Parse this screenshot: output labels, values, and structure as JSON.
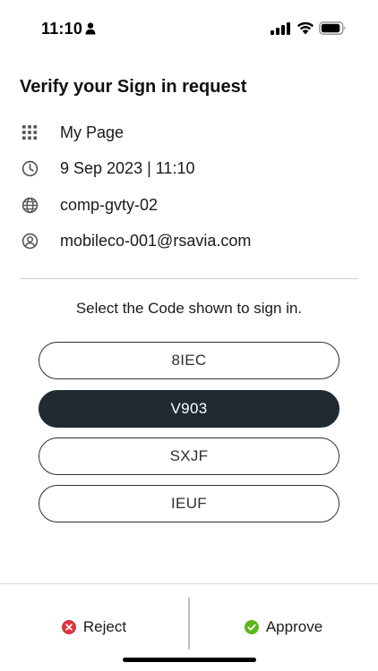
{
  "status_bar": {
    "time": "11:10"
  },
  "title": "Verify your Sign in request",
  "info": {
    "app": "My Page",
    "datetime": "9 Sep 2023 | 11:10",
    "device": "comp-gvty-02",
    "account": "mobileco-001@rsavia.com"
  },
  "prompt": "Select the Code shown to sign in.",
  "codes": [
    {
      "label": "8IEC",
      "selected": false
    },
    {
      "label": "V903",
      "selected": true
    },
    {
      "label": "SXJF",
      "selected": false
    },
    {
      "label": "IEUF",
      "selected": false
    }
  ],
  "actions": {
    "reject_label": "Reject",
    "approve_label": "Approve"
  },
  "icons": {
    "app": "grid-icon",
    "datetime": "clock-icon",
    "device": "globe-icon",
    "account": "user-circle-icon",
    "reject": "x-circle-icon",
    "approve": "check-circle-icon"
  },
  "colors": {
    "selected_bg": "#1f2a33",
    "reject": "#d9363e",
    "approve": "#5cb71a"
  }
}
